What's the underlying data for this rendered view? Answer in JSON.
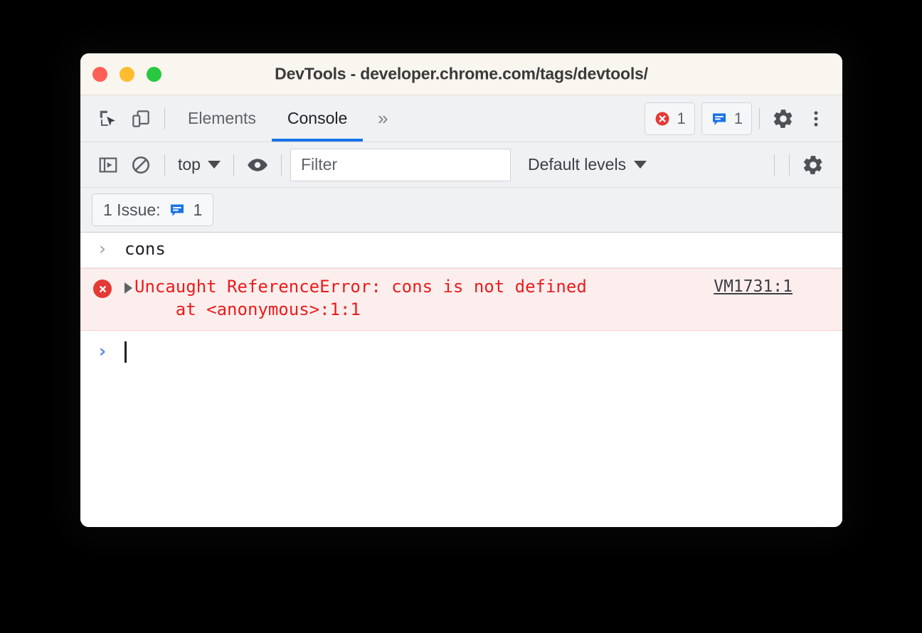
{
  "window": {
    "title": "DevTools - developer.chrome.com/tags/devtools/",
    "traffic_lights": {
      "close": "close-window",
      "minimize": "minimize-window",
      "zoom": "zoom-window"
    }
  },
  "tabstrip": {
    "inspect_icon": "inspect-element-icon",
    "device_toolbar_icon": "device-toolbar-icon",
    "tabs": [
      {
        "label": "Elements",
        "active": false
      },
      {
        "label": "Console",
        "active": true
      }
    ],
    "more_tabs_label": "»",
    "error_badge": {
      "icon": "error-circle-icon",
      "count": "1"
    },
    "issues_badge": {
      "icon": "issues-speech-bubble-icon",
      "count": "1"
    },
    "settings_icon": "gear-icon",
    "more_options_icon": "three-dot-menu-icon"
  },
  "console_toolbar": {
    "sidebar_toggle_icon": "console-sidebar-toggle-icon",
    "clear_console_icon": "clear-console-icon",
    "context_selector": {
      "value": "top",
      "caret": "chevron-down-icon"
    },
    "live_expression_icon": "eye-icon",
    "filter": {
      "value": "",
      "placeholder": "Filter"
    },
    "log_levels": {
      "value": "Default levels",
      "caret": "chevron-down-icon"
    },
    "settings_icon": "gear-icon"
  },
  "issues_bar": {
    "label": "1 Issue:",
    "icon": "issues-speech-bubble-icon",
    "count": "1"
  },
  "console": {
    "entries": [
      {
        "type": "input",
        "prompt": "›",
        "text": "cons"
      },
      {
        "type": "error",
        "icon": "error-circle-icon",
        "expander": "expand-triangle-icon",
        "message_line1": "Uncaught ReferenceError: cons is not defined",
        "message_line2": "    at <anonymous>:1:1",
        "source": "VM1731:1"
      },
      {
        "type": "prompt",
        "prompt": "›",
        "text": ""
      }
    ]
  },
  "colors": {
    "accent_blue": "#1a73e8",
    "error_red": "#eb1c1c",
    "error_bg": "#fdeeee",
    "issues_blue": "#1a73e8",
    "toolbar_bg": "#eff1f3",
    "titlebar_bg": "#f9f5ef"
  }
}
